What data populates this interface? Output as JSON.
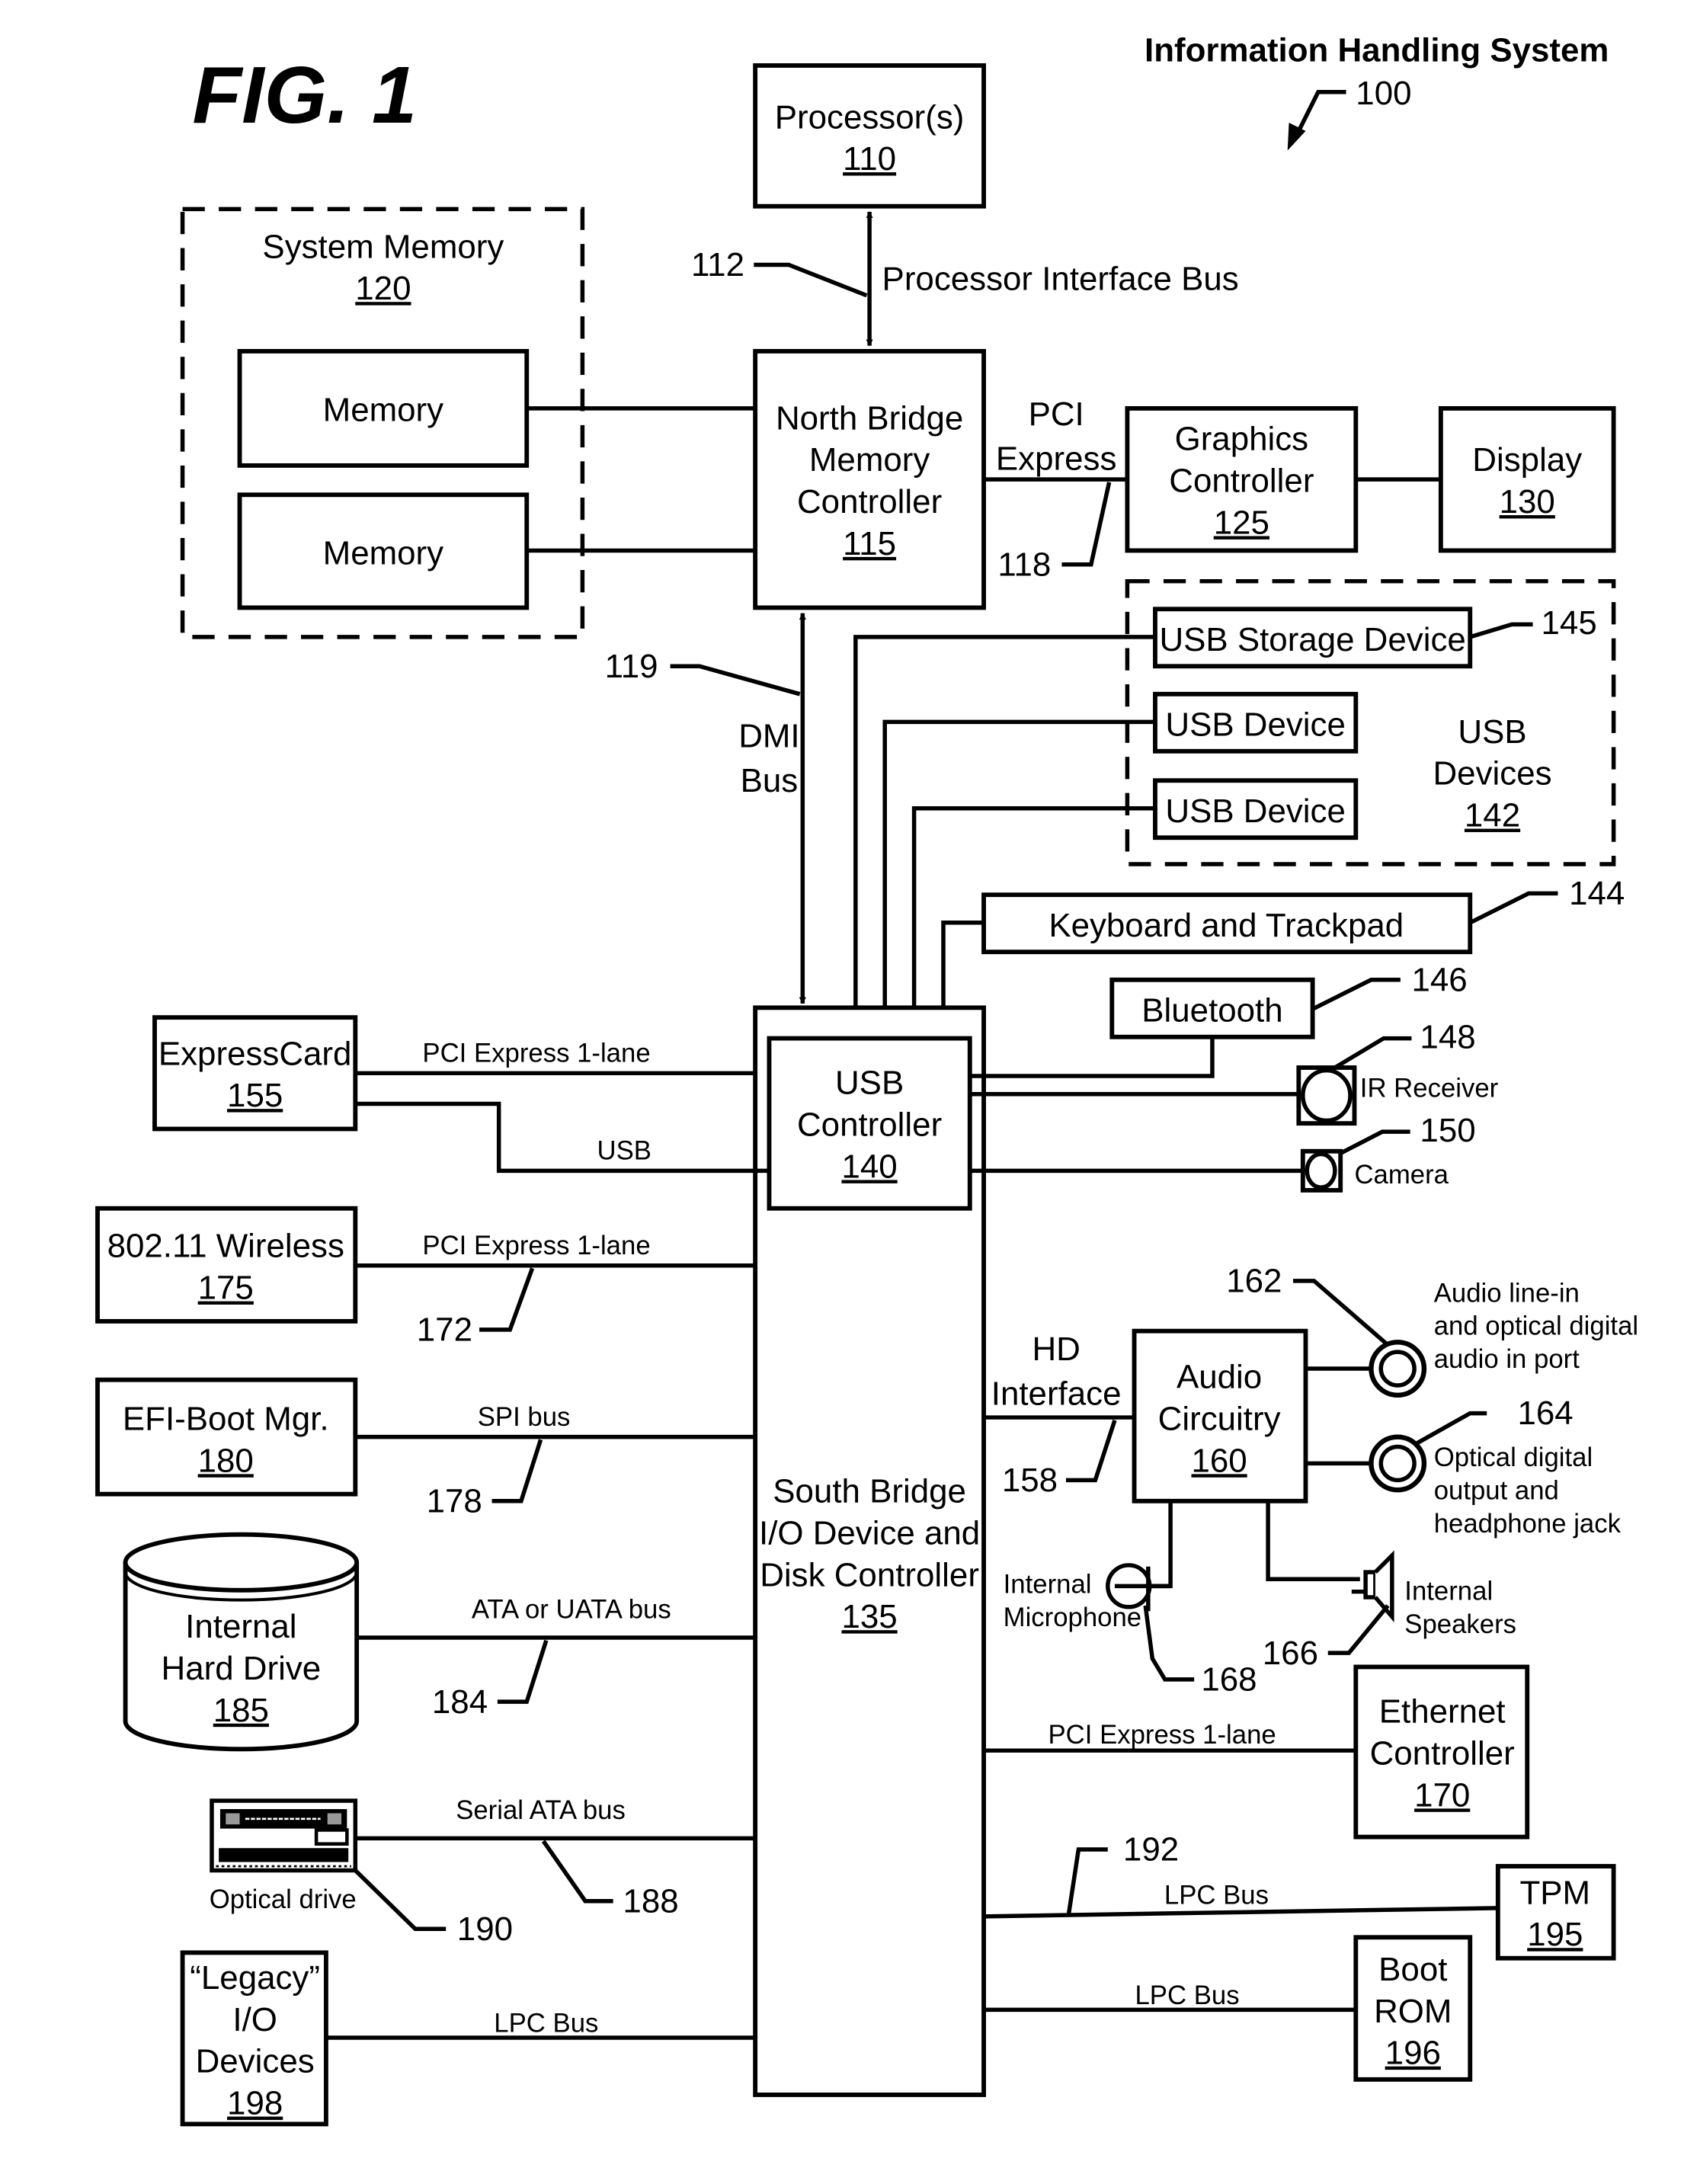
{
  "figure": {
    "label": "FIG. 1",
    "title": "Information Handling System",
    "ref": "100"
  },
  "colors": {
    "ink": "#000000",
    "paper": "#ffffff"
  },
  "nodes": {
    "processor": {
      "lines": [
        "Processor(s)"
      ],
      "ref": "110"
    },
    "system_memory": {
      "lines": [
        "System Memory"
      ],
      "ref": "120"
    },
    "memory_1": {
      "lines": [
        "Memory"
      ]
    },
    "memory_2": {
      "lines": [
        "Memory"
      ]
    },
    "north_bridge": {
      "lines": [
        "North Bridge",
        "Memory",
        "Controller"
      ],
      "ref": "115"
    },
    "graphics": {
      "lines": [
        "Graphics",
        "Controller"
      ],
      "ref": "125"
    },
    "display": {
      "lines": [
        "Display"
      ],
      "ref": "130"
    },
    "usb_devices": {
      "lines": [
        "USB",
        "Devices"
      ],
      "ref": "142"
    },
    "usb_storage": {
      "lines": [
        "USB Storage Device"
      ]
    },
    "usb_device_1": {
      "lines": [
        "USB Device"
      ]
    },
    "usb_device_2": {
      "lines": [
        "USB Device"
      ]
    },
    "keyboard": {
      "lines": [
        "Keyboard and Trackpad"
      ]
    },
    "bluetooth": {
      "lines": [
        "Bluetooth"
      ]
    },
    "usb_controller": {
      "lines": [
        "USB",
        "Controller"
      ],
      "ref": "140"
    },
    "south_bridge": {
      "lines": [
        "South Bridge",
        "I/O Device and",
        "Disk Controller"
      ],
      "ref": "135"
    },
    "expresscard": {
      "lines": [
        "ExpressCard"
      ],
      "ref": "155"
    },
    "wireless": {
      "lines": [
        "802.11 Wireless"
      ],
      "ref": "175"
    },
    "efi_boot": {
      "lines": [
        "EFI-Boot Mgr."
      ],
      "ref": "180"
    },
    "hard_drive": {
      "lines": [
        "Internal",
        "Hard Drive"
      ],
      "ref": "185"
    },
    "optical_drive": {
      "lines": [
        "Optical drive"
      ]
    },
    "legacy_io": {
      "lines": [
        "“Legacy”",
        "I/O",
        "Devices"
      ],
      "ref": "198"
    },
    "audio": {
      "lines": [
        "Audio",
        "Circuitry"
      ],
      "ref": "160"
    },
    "ethernet": {
      "lines": [
        "Ethernet",
        "Controller"
      ],
      "ref": "170"
    },
    "tpm": {
      "lines": [
        "TPM"
      ],
      "ref": "195"
    },
    "boot_rom": {
      "lines": [
        "Boot",
        "ROM"
      ],
      "ref": "196"
    },
    "ir_receiver": {
      "lines": [
        "IR Receiver"
      ]
    },
    "camera": {
      "lines": [
        "Camera"
      ]
    },
    "audio_line_in": {
      "lines": [
        "Audio line-in",
        "and optical digital",
        "audio in port"
      ]
    },
    "optical_out": {
      "lines": [
        "Optical digital",
        "output and",
        "headphone jack"
      ]
    },
    "microphone": {
      "lines": [
        "Internal",
        "Microphone"
      ]
    },
    "speakers": {
      "lines": [
        "Internal",
        "Speakers"
      ]
    }
  },
  "buses": {
    "processor_interface": "Processor Interface Bus",
    "pci_express": [
      "PCI",
      "Express"
    ],
    "dmi": [
      "DMI",
      "Bus"
    ],
    "hd_interface": [
      "HD",
      "Interface"
    ],
    "expresscard_pcie": "PCI Express 1-lane",
    "expresscard_usb": "USB",
    "wireless_pcie": "PCI Express 1-lane",
    "spi": "SPI bus",
    "ata": "ATA or UATA bus",
    "sata": "Serial ATA bus",
    "legacy_lpc": "LPC Bus",
    "ethernet_pcie": "PCI Express 1-lane",
    "tpm_lpc": "LPC Bus",
    "bootrom_lpc": "LPC Bus"
  },
  "refs": {
    "r112": "112",
    "r118": "118",
    "r119": "119",
    "r144": "144",
    "r145": "145",
    "r146": "146",
    "r148": "148",
    "r150": "150",
    "r158": "158",
    "r162": "162",
    "r164": "164",
    "r166": "166",
    "r168": "168",
    "r172": "172",
    "r178": "178",
    "r184": "184",
    "r188": "188",
    "r190": "190",
    "r192": "192"
  }
}
